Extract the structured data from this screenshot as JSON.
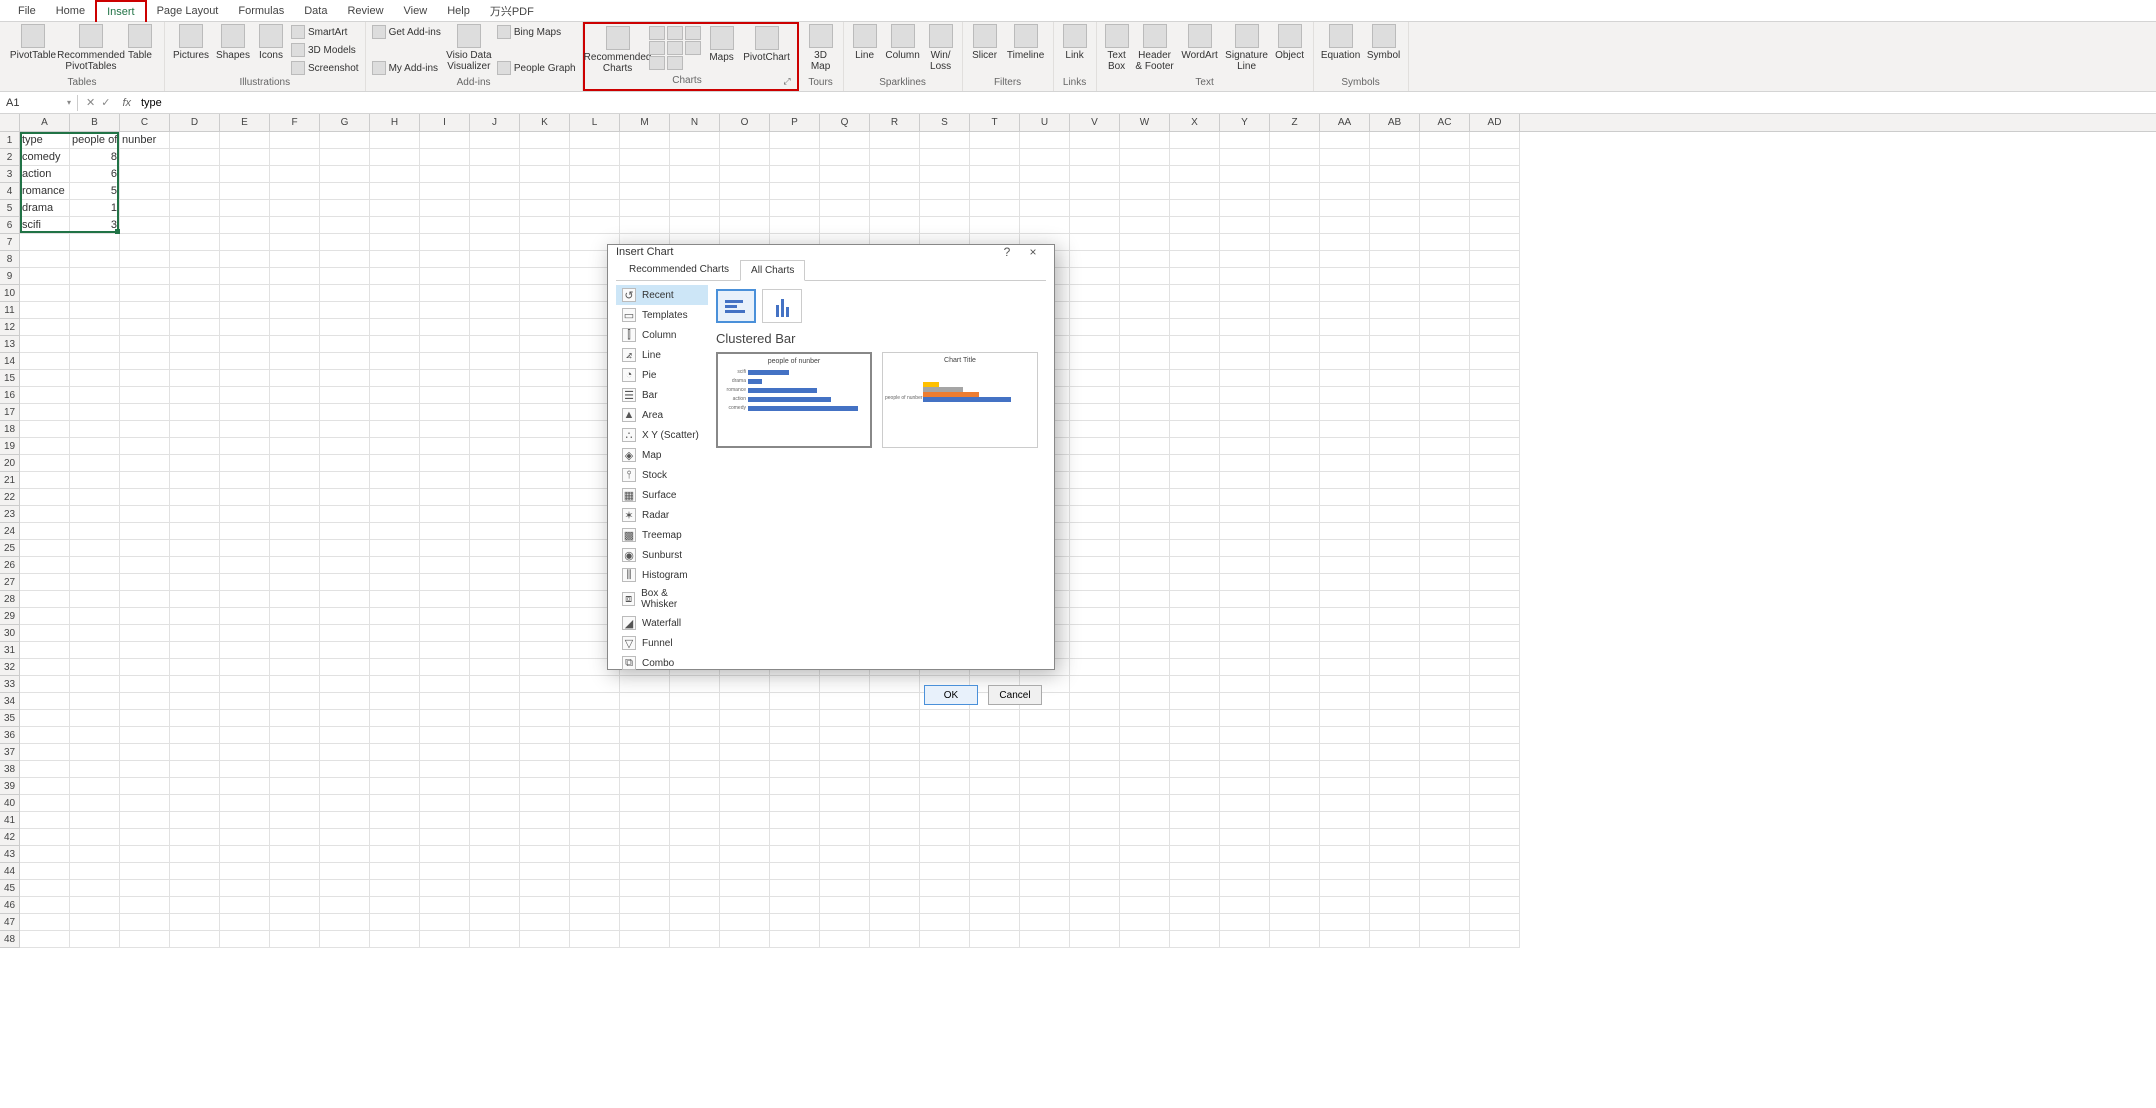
{
  "tabs": [
    "File",
    "Home",
    "Insert",
    "Page Layout",
    "Formulas",
    "Data",
    "Review",
    "View",
    "Help",
    "万兴PDF"
  ],
  "active_tab": "Insert",
  "ribbon": {
    "groups": [
      {
        "label": "Tables",
        "items": [
          {
            "label": "PivotTable"
          },
          {
            "label": "Recommended\nPivotTables"
          },
          {
            "label": "Table"
          }
        ]
      },
      {
        "label": "Illustrations",
        "large": [
          {
            "label": "Pictures"
          },
          {
            "label": "Shapes"
          },
          {
            "label": "Icons"
          }
        ],
        "small": [
          {
            "label": "SmartArt"
          },
          {
            "label": "3D Models"
          },
          {
            "label": "Screenshot"
          }
        ]
      },
      {
        "label": "Add-ins",
        "small": [
          {
            "label": "Get Add-ins"
          },
          {
            "label": "My Add-ins"
          }
        ],
        "large": [
          {
            "label": "Visio Data\nVisualizer"
          }
        ],
        "small2": [
          {
            "label": "Bing Maps"
          },
          {
            "label": "People Graph"
          }
        ]
      },
      {
        "label": "Charts",
        "large": [
          {
            "label": "Recommended\nCharts"
          }
        ],
        "large2": [
          {
            "label": "Maps"
          },
          {
            "label": "PivotChart"
          }
        ],
        "highlight": true
      },
      {
        "label": "Tours",
        "large": [
          {
            "label": "3D\nMap"
          }
        ]
      },
      {
        "label": "Sparklines",
        "large": [
          {
            "label": "Line"
          },
          {
            "label": "Column"
          },
          {
            "label": "Win/\nLoss"
          }
        ]
      },
      {
        "label": "Filters",
        "large": [
          {
            "label": "Slicer"
          },
          {
            "label": "Timeline"
          }
        ]
      },
      {
        "label": "Links",
        "large": [
          {
            "label": "Link"
          }
        ]
      },
      {
        "label": "Text",
        "large": [
          {
            "label": "Text\nBox"
          },
          {
            "label": "Header\n& Footer"
          },
          {
            "label": "WordArt"
          },
          {
            "label": "Signature\nLine"
          },
          {
            "label": "Object"
          }
        ]
      },
      {
        "label": "Symbols",
        "large": [
          {
            "label": "Equation"
          },
          {
            "label": "Symbol"
          }
        ]
      }
    ]
  },
  "name_box": "A1",
  "formula_value": "type",
  "columns": [
    "A",
    "B",
    "C",
    "D",
    "E",
    "F",
    "G",
    "H",
    "I",
    "J",
    "K",
    "L",
    "M",
    "N",
    "O",
    "P",
    "Q",
    "R",
    "S",
    "T",
    "U",
    "V",
    "W",
    "X",
    "Y",
    "Z",
    "AA",
    "AB",
    "AC",
    "AD"
  ],
  "cells": {
    "A1": "type",
    "B1": "people of",
    "C1": "nunber",
    "A2": "comedy",
    "B2": "8",
    "A3": "action",
    "B3": "6",
    "A4": "romance",
    "B4": "5",
    "A5": "drama",
    "B5": "1",
    "A6": "scifi",
    "B6": "3"
  },
  "selection": {
    "rows": [
      1,
      6
    ],
    "cols": [
      1,
      2
    ]
  },
  "dialog": {
    "title": "Insert Chart",
    "help": "?",
    "close": "×",
    "tabs": [
      "Recommended Charts",
      "All Charts"
    ],
    "active_tab": "All Charts",
    "chart_types": [
      "Recent",
      "Templates",
      "Column",
      "Line",
      "Pie",
      "Bar",
      "Area",
      "X Y (Scatter)",
      "Map",
      "Stock",
      "Surface",
      "Radar",
      "Treemap",
      "Sunburst",
      "Histogram",
      "Box & Whisker",
      "Waterfall",
      "Funnel",
      "Combo"
    ],
    "selected_type": "Recent",
    "subtype_title": "Clustered Bar",
    "preview1_title": "people of nunber",
    "preview2_title": "Chart Title",
    "preview2_ylabel": "people of nunber",
    "ok": "OK",
    "cancel": "Cancel"
  },
  "chart_data": {
    "type": "bar",
    "orientation": "horizontal",
    "title": "people of nunber",
    "categories": [
      "scifi",
      "drama",
      "romance",
      "action",
      "comedy"
    ],
    "values": [
      3,
      1,
      5,
      6,
      8
    ],
    "xlim": [
      0,
      9
    ],
    "xlabel": "",
    "ylabel": ""
  },
  "ct_icons": [
    "↺",
    "▭",
    "⫿",
    "⦨",
    "◔",
    "☰",
    "▲",
    "∴",
    "◈",
    "⫯",
    "▦",
    "✶",
    "▩",
    "◉",
    "⫼",
    "⧈",
    "◢",
    "▽",
    "⧉"
  ]
}
